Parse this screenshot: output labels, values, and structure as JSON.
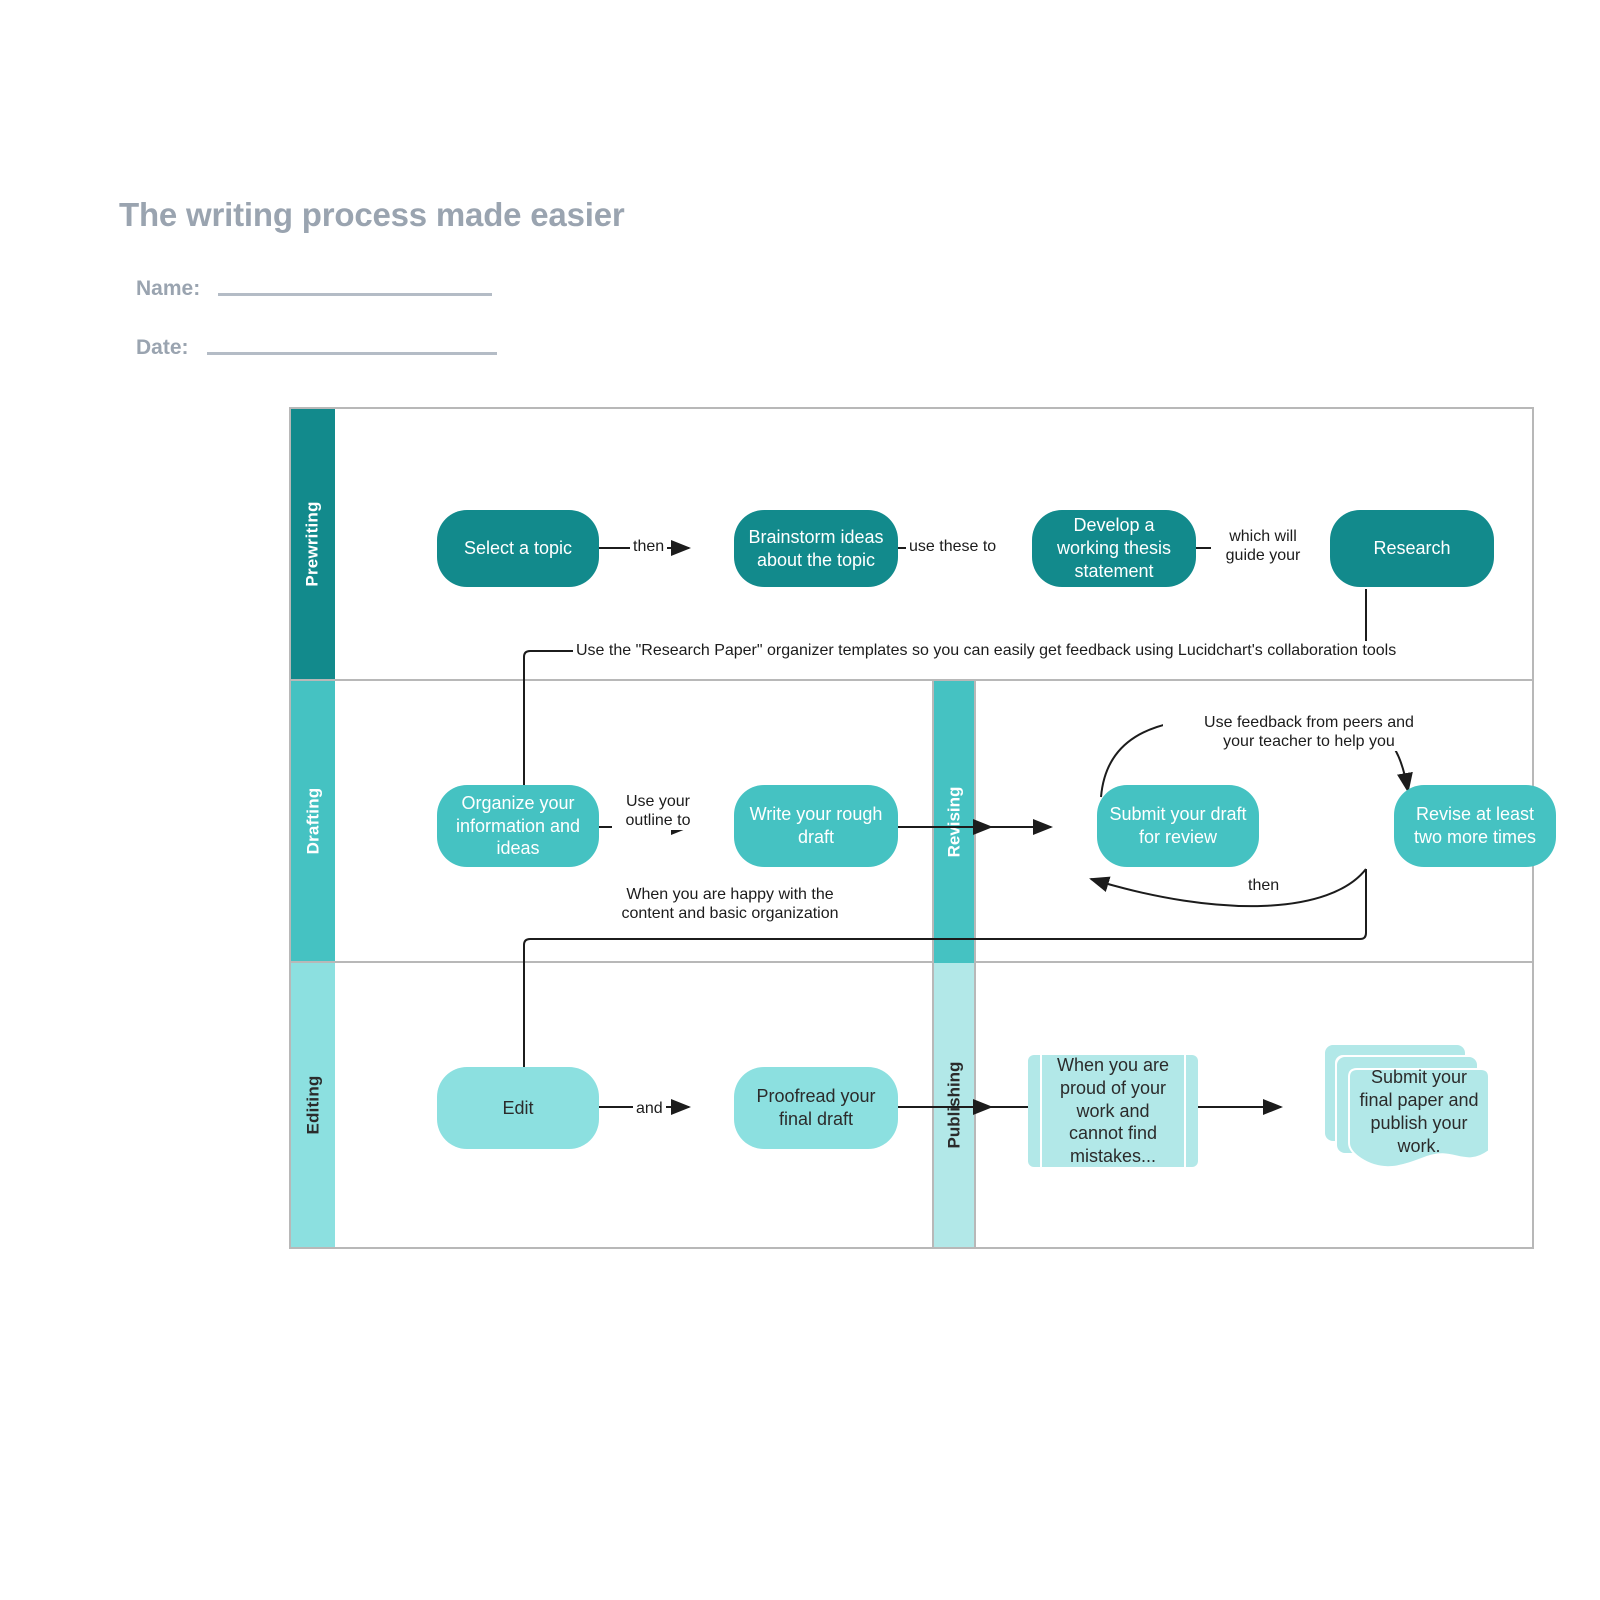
{
  "header": {
    "title": "The writing process made easier",
    "name_label": "Name:",
    "date_label": "Date:"
  },
  "lanes": [
    {
      "id": "prewriting",
      "label": "Prewriting",
      "color": "#128a8c",
      "text_color": "#ffffff"
    },
    {
      "id": "drafting",
      "label": "Drafting",
      "color": "#45c2c2",
      "text_color": "#ffffff"
    },
    {
      "id": "editing",
      "label": "Editing",
      "color": "#8ce0e0",
      "text_color": "#2b2b2b"
    }
  ],
  "sublanes": [
    {
      "id": "revising",
      "label": "Revising",
      "color": "#45c2c2",
      "text_color": "#ffffff"
    },
    {
      "id": "publishing",
      "label": "Publishing",
      "color": "#b2e8e8",
      "text_color": "#2b2b2b"
    }
  ],
  "nodes": {
    "select_topic": "Select a topic",
    "brainstorm": "Brainstorm ideas\nabout the topic",
    "thesis": "Develop a\nworking thesis\nstatement",
    "research": "Research",
    "organize": "Organize your\ninformation and\nideas",
    "rough_draft": "Write your rough\ndraft",
    "submit_draft": "Submit your draft\nfor review",
    "revise": "Revise at least\ntwo more times",
    "edit": "Edit",
    "proofread": "Proofread your\nfinal draft",
    "proud": "When you are\nproud of your\nwork and\ncannot find\nmistakes...",
    "publish": "Submit your\nfinal paper and\npublish your\nwork."
  },
  "connector_labels": {
    "then1": "then",
    "use_these_to": "use these to",
    "which_will_guide_your": "which will\nguide your",
    "research_paper_note": "Use the \"Research Paper\" organizer templates so you can easily get feedback using Lucidchart's collaboration tools",
    "use_your_outline_to": "Use your\noutline to",
    "use_feedback": "Use feedback from peers and\nyour teacher to help you",
    "then2": "then",
    "happy_with_content": "When you are happy with the\ncontent and basic organization",
    "and": "and"
  },
  "chart_data": {
    "type": "diagram",
    "title": "The writing process made easier",
    "diagram_kind": "swimlane-flowchart",
    "steps": [
      {
        "lane": "Prewriting",
        "step": "Select a topic"
      },
      {
        "lane": "Prewriting",
        "step": "Brainstorm ideas about the topic"
      },
      {
        "lane": "Prewriting",
        "step": "Develop a working thesis statement"
      },
      {
        "lane": "Prewriting",
        "step": "Research"
      },
      {
        "lane": "Drafting",
        "step": "Organize your information and ideas"
      },
      {
        "lane": "Drafting",
        "step": "Write your rough draft"
      },
      {
        "lane": "Revising",
        "step": "Submit your draft for review"
      },
      {
        "lane": "Revising",
        "step": "Revise at least two more times"
      },
      {
        "lane": "Editing",
        "step": "Edit"
      },
      {
        "lane": "Editing",
        "step": "Proofread your final draft"
      },
      {
        "lane": "Publishing",
        "step": "When you are proud of your work and cannot find mistakes..."
      },
      {
        "lane": "Publishing",
        "step": "Submit your final paper and publish your work."
      }
    ],
    "edges": [
      {
        "from": "Select a topic",
        "to": "Brainstorm ideas about the topic",
        "label": "then"
      },
      {
        "from": "Brainstorm ideas about the topic",
        "to": "Develop a working thesis statement",
        "label": "use these to"
      },
      {
        "from": "Develop a working thesis statement",
        "to": "Research",
        "label": "which will guide your"
      },
      {
        "from": "Research",
        "to": "Organize your information and ideas",
        "label": "Use the \"Research Paper\" organizer templates so you can easily get feedback using Lucidchart's collaboration tools"
      },
      {
        "from": "Organize your information and ideas",
        "to": "Write your rough draft",
        "label": "Use your outline to"
      },
      {
        "from": "Write your rough draft",
        "to": "Submit your draft for review",
        "label": ""
      },
      {
        "from": "Submit your draft for review",
        "to": "Revise at least two more times",
        "label": "Use feedback from peers and your teacher to help you"
      },
      {
        "from": "Revise at least two more times",
        "to": "Submit your draft for review",
        "label": "then"
      },
      {
        "from": "Revise at least two more times",
        "to": "Edit",
        "label": "When you are happy with the content and basic organization"
      },
      {
        "from": "Edit",
        "to": "Proofread your final draft",
        "label": "and"
      },
      {
        "from": "Proofread your final draft",
        "to": "When you are proud of your work and cannot find mistakes...",
        "label": ""
      },
      {
        "from": "When you are proud of your work and cannot find mistakes...",
        "to": "Submit your final paper and publish your work.",
        "label": ""
      }
    ]
  }
}
